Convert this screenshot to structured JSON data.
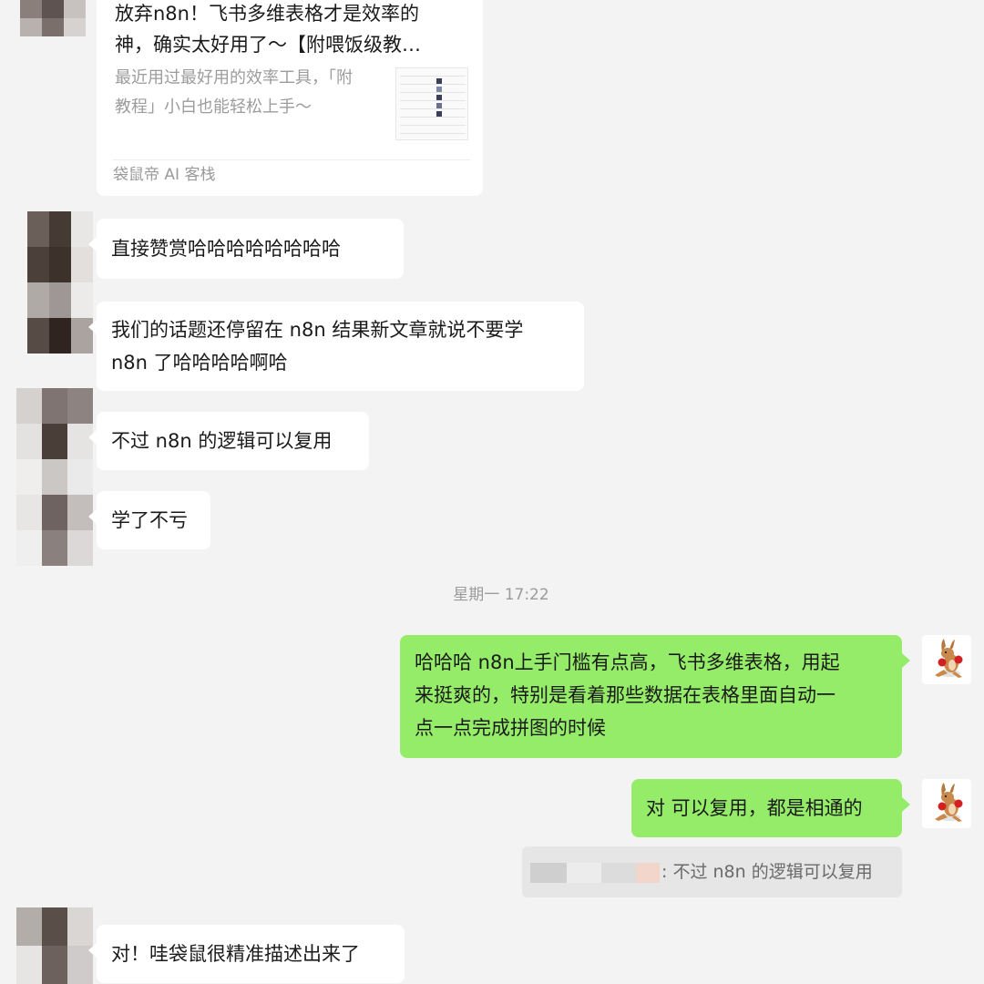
{
  "link_card": {
    "title_line1": "放弃n8n！飞书多维表格才是效率的",
    "title_line2": "神，确实太好用了～【附喂饭级教…",
    "desc_line1": "最近用过最好用的效率工具，「附",
    "desc_line2": "教程」小白也能轻松上手～",
    "source": "袋鼠帝 AI 客栈"
  },
  "messages_in_1": [
    {
      "text": "直接赞赏哈哈哈哈哈哈哈哈"
    },
    {
      "line1": "我们的话题还停留在 n8n 结果新文章就说不要学",
      "line2": "n8n 了哈哈哈哈啊哈"
    },
    {
      "text": "不过 n8n 的逻辑可以复用"
    },
    {
      "text": "学了不亏"
    }
  ],
  "timestamp": "星期一 17:22",
  "messages_out": [
    {
      "line1": "哈哈哈 n8n上手门槛有点高，飞书多维表格，用起",
      "line2": "来挺爽的，特别是看着那些数据在表格里面自动一",
      "line3": "点一点完成拼图的时候"
    },
    {
      "text": "对 可以复用，都是相通的"
    }
  ],
  "quote": {
    "text": ": 不过 n8n 的逻辑可以复用"
  },
  "messages_in_2": [
    {
      "text": "对！哇袋鼠很精准描述出来了"
    }
  ],
  "colors": {
    "background": "#f3f3f3",
    "incoming_bubble": "#ffffff",
    "outgoing_bubble": "#95ec69",
    "meta_text": "#9b9b9b"
  },
  "icons": {
    "self_avatar": "kangaroo-boxer-avatar",
    "contact_avatar": "pixelated-avatar"
  }
}
